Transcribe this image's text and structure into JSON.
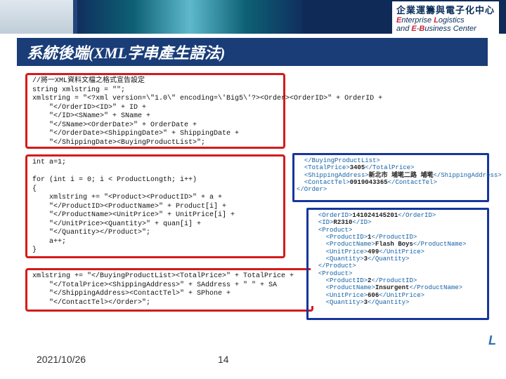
{
  "header": {
    "title_cn": "企業運籌與電子化中心",
    "title_en_parts": [
      "E",
      "nterprise ",
      "L",
      "ogistics",
      " and ",
      "E",
      "-",
      "B",
      "usiness Center"
    ]
  },
  "slide": {
    "title": "系統後端(XML字串產生語法)"
  },
  "code_block1": "//將一XML資料文檔之格式宣告設定\nstring xmlstring = \"\";\nxmlstring = \"<?xml version=\\\"1.0\\\" encoding=\\'Big5\\'?><Order><OrderID>\" + OrderID +\n    \"</OrderID><ID>\" + ID +\n    \"</ID><SName>\" + SName +\n    \"</SName><OrderDate>\" + OrderDate +\n    \"</OrderDate><ShippingDate>\" + ShippingDate +\n    \"</ShippingDate><BuyingProductList>\";",
  "code_block2": "int a=1;\n\nfor (int i = 0; i < ProductLongth; i++)\n{\n    xmlstring += \"<Product><ProductID>\" + a +\n    \"</ProductID><ProductName>\" + Product[i] +\n    \"</ProductName><UnitPrice>\" + UnitPrice[i] +\n    \"</UnitPrice><Quantity>\" + quan[i] + \n    \"</Quantity></Product>\";\n    a++;\n}",
  "code_block3": "xmlstring += \"</BuyingProductList><TotalPrice>\" + TotalPrice +\n    \"</TotalPrice><ShippingAddress>\" + SAddress + \" \" + SA\n    \"</ShippingAddress><ContactTel>\" + SPhone +\n    \"</ContactTel></Order>\";",
  "xml_top": "  </BuyingProductList>\n  <TotalPrice>3405</TotalPrice>\n  <ShippingAddress>新北市 埔墘二路 埔墘</ShippingAddress>\n  <ContactTel>0919043365</ContactTel>\n</Order>",
  "xml_bot": "  <OrderID>141024145201</OrderID>\n  <ID>R2310</ID>\n  <Product>\n    <ProductID>1</ProductID>\n    <ProductName>Flash Boys</ProductName>\n    <UnitPrice>499</UnitPrice>\n    <Quantity>3</Quantity>\n  </Product>\n  <Product>\n    <ProductID>2</ProductID>\n    <ProductName>Insurgent</ProductName>\n    <UnitPrice>606</UnitPrice>\n    <Quantity>3</Quantity>",
  "footer": {
    "date": "2021/10/26",
    "page": "14"
  },
  "logo": "L"
}
